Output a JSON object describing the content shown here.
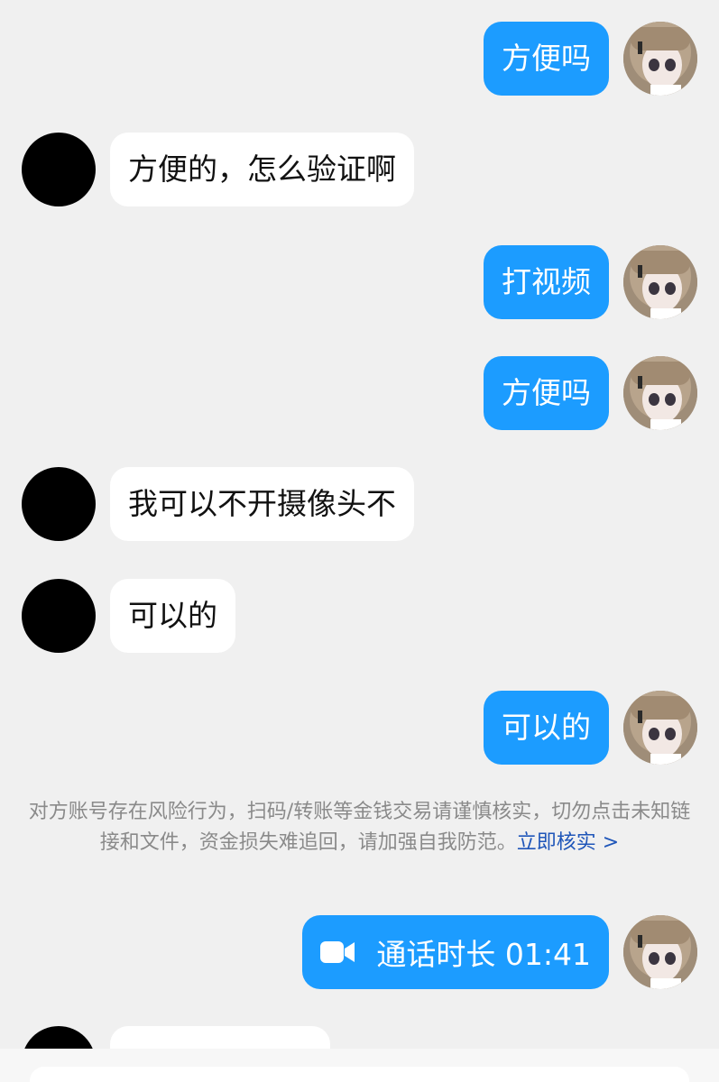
{
  "colors": {
    "self_bubble": "#1c9cff",
    "peer_bubble": "#ffffff",
    "background": "#f0f0f0",
    "notice_text": "#8a8a8a",
    "link": "#1f56b9"
  },
  "messages": [
    {
      "sender": "self",
      "text": "方便吗"
    },
    {
      "sender": "peer",
      "text": "方便的，怎么验证啊"
    },
    {
      "sender": "self",
      "text": "打视频"
    },
    {
      "sender": "self",
      "text": "方便吗"
    },
    {
      "sender": "peer",
      "text": "我可以不开摄像头不"
    },
    {
      "sender": "peer",
      "text": "可以的"
    },
    {
      "sender": "self",
      "text": "可以的"
    }
  ],
  "notice": {
    "text": "对方账号存在风险行为，扫码/转账等金钱交易请谨慎核实，切勿点击未知链接和文件，资金损失难追回，请加强自我防范。",
    "link_label": "立即核实 >"
  },
  "call": {
    "icon": "video-camera-icon",
    "label": "通话时长 01:41"
  }
}
